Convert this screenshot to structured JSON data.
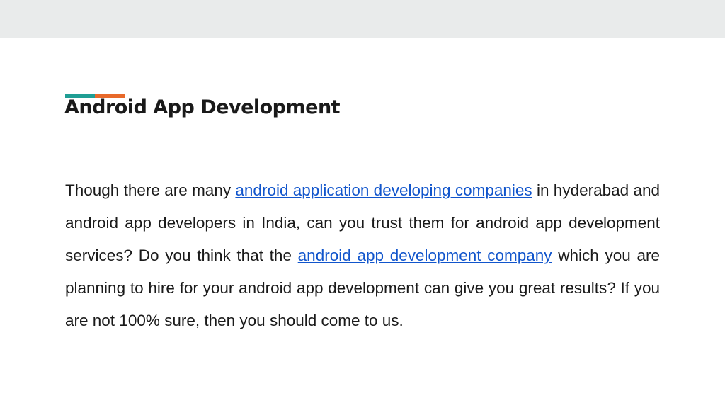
{
  "slide": {
    "title": "Android App Development",
    "paragraph": {
      "text_1": "Though there are many ",
      "link_1": "android application developing companies",
      "text_2": " in hyderabad and android app developers in India, can you trust them for android app development services? Do you think that the ",
      "link_2": "android app development company",
      "text_3": " which you are planning to hire for your android app development can give you great results? If you are not 100% sure, then you should come to us."
    }
  },
  "colors": {
    "accent_teal": "#1f9e94",
    "accent_orange": "#e8692a",
    "link": "#1155cc",
    "top_band": "#e9ebeb"
  }
}
